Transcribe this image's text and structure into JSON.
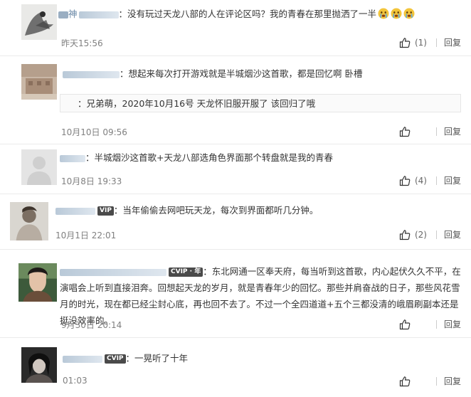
{
  "comments": [
    {
      "username": "神",
      "vip": "",
      "text": "：没有玩过天龙八部的人在评论区吗？我的青春在那里抛洒了一半",
      "time": "昨天15:56",
      "likes": "(1)",
      "reply": "回复",
      "emoji_count": 3,
      "avatar_icon": "ink-painting-avatar"
    },
    {
      "username": "",
      "vip": "",
      "text": "：想起来每次打开游戏就是半城烟沙这首歌，都是回忆啊 卧槽",
      "quote": "：兄弟萌，2020年10月16号 天龙怀旧服开服了 该回归了哦",
      "time": "10月10日 09:56",
      "likes": "",
      "reply": "回复",
      "avatar_icon": "building-avatar"
    },
    {
      "username": "",
      "vip": "",
      "text": "：半城烟沙这首歌+天龙八部选角色界面那个转盘就是我的青春",
      "time": "10月8日 19:33",
      "likes": "(4)",
      "reply": "回复",
      "avatar_icon": "default-user-avatar"
    },
    {
      "username": "",
      "vip": "VIP",
      "text": "：当年偷偷去网吧玩天龙，每次到界面都听几分钟。",
      "time": "10月1日 22:01",
      "likes": "(2)",
      "reply": "回复",
      "avatar_icon": "portrait-avatar"
    },
    {
      "username": "",
      "vip": "CVIP · 年",
      "text": "：东北网通一区奉天府，每当听到这首歌，内心起伏久久不平，在演唱会上听到直接泪奔。回想起天龙的岁月，就是青春年少的回忆。那些并肩奋战的日子，那些风花雪月的时光，现在都已经尘封心底，再也回不去了。不过一个全四道道+五个三都没清的峨眉刷副本还是挺没效率的。",
      "time": "9月30日 20:14",
      "likes": "",
      "reply": "回复",
      "avatar_icon": "actor-avatar"
    },
    {
      "username": "",
      "vip": "CVIP",
      "text": "：一晃听了十年",
      "time": "01:03",
      "likes": "",
      "reply": "回复",
      "avatar_icon": "dark-portrait-avatar"
    }
  ],
  "colors": {
    "link_blue": "#b9c9d8",
    "time_gray": "#808080",
    "divider": "#ebebeb",
    "vip_bg": "#4a4a4a",
    "emoji_yellow": "#f3c53a"
  }
}
